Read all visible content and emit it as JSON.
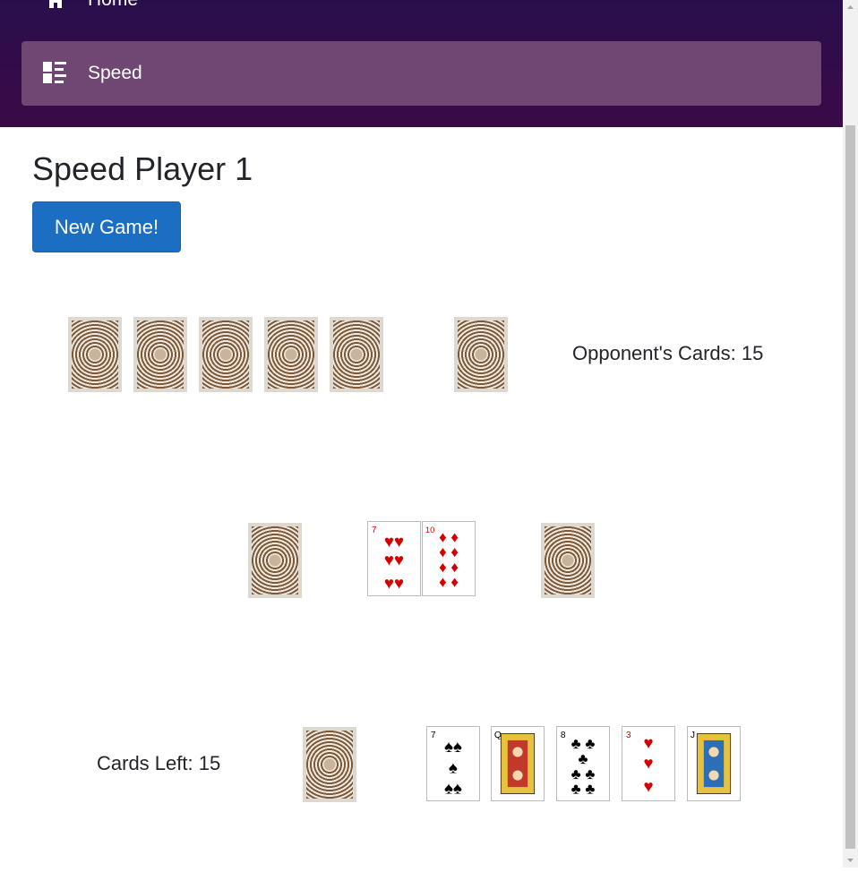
{
  "nav": {
    "home_label": "Home",
    "speed_label": "Speed"
  },
  "page_title": "Speed Player 1",
  "new_game_label": "New Game!",
  "opponent": {
    "label": "Opponent's Cards: 15",
    "hand_count": 5,
    "draw_pile_count": 1
  },
  "center": {
    "left_pile": "face-down",
    "piles": [
      {
        "rank": "7",
        "suit": "hearts",
        "color": "#d40000"
      },
      {
        "rank": "10",
        "suit": "diamonds",
        "color": "#d40000"
      }
    ],
    "right_pile": "face-down"
  },
  "player": {
    "label": "Cards Left: 15",
    "hand": [
      {
        "rank": "7",
        "suit": "spades",
        "color": "#000000"
      },
      {
        "rank": "Q",
        "suit": "clubs",
        "color": "#000000"
      },
      {
        "rank": "8",
        "suit": "clubs",
        "color": "#000000"
      },
      {
        "rank": "3",
        "suit": "hearts",
        "color": "#d40000"
      },
      {
        "rank": "J",
        "suit": "spades",
        "color": "#000000"
      }
    ]
  },
  "colors": {
    "nav_bg": "#2a0e4c",
    "nav_active": "#704673",
    "button_bg": "#1b6ec2",
    "card_back": "#7a5a3a"
  }
}
